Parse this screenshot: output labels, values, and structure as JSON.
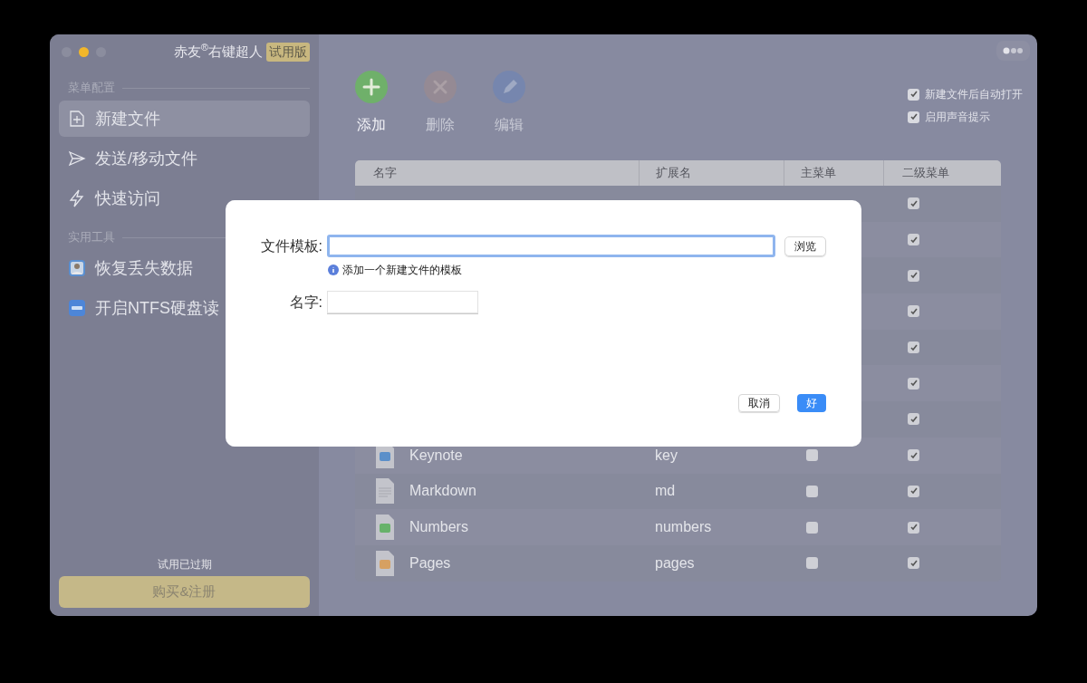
{
  "window": {
    "title": "赤友$^{®}$右键超人",
    "badge": "试用版"
  },
  "sidebar": {
    "sections": [
      {
        "title": "菜单配置",
        "items": [
          {
            "label": "新建文件",
            "kind": "file-plus",
            "selected": true
          },
          {
            "label": "发送/移动文件",
            "kind": "send",
            "selected": false
          },
          {
            "label": "快速访问",
            "kind": "bolt",
            "selected": false
          }
        ]
      },
      {
        "title": "实用工具",
        "items": [
          {
            "label": "恢复丢失数据",
            "kind": "app-person",
            "selected": false
          },
          {
            "label": "开启NTFS硬盘读",
            "kind": "app-disk",
            "selected": false
          }
        ]
      }
    ],
    "trial_note": "试用已过期",
    "buy_button": "购买&注册"
  },
  "toolbar": [
    {
      "label": "添加",
      "kind": "add",
      "disabled": false
    },
    {
      "label": "删除",
      "kind": "delete",
      "disabled": true
    },
    {
      "label": "编辑",
      "kind": "edit",
      "disabled": true
    }
  ],
  "options": [
    {
      "label": "新建文件后自动打开",
      "checked": true
    },
    {
      "label": "启用声音提示",
      "checked": true
    }
  ],
  "table": {
    "columns": [
      "名字",
      "扩展名",
      "主菜单",
      "二级菜单"
    ],
    "rows": [
      {
        "submenu": true
      },
      {
        "submenu": true
      },
      {
        "submenu": true
      },
      {
        "submenu": true
      },
      {
        "submenu": true
      },
      {
        "submenu": true
      },
      {
        "submenu": true
      },
      {
        "name": "Keynote",
        "extension": "key",
        "kind": "keynote",
        "main_menu": false,
        "submenu": true
      },
      {
        "name": "Markdown",
        "extension": "md",
        "kind": "text",
        "main_menu": false,
        "submenu": true
      },
      {
        "name": "Numbers",
        "extension": "numbers",
        "kind": "numbers",
        "main_menu": false,
        "submenu": true
      },
      {
        "name": "Pages",
        "extension": "pages",
        "kind": "pages",
        "main_menu": false,
        "submenu": true
      }
    ]
  },
  "dialog": {
    "fields": [
      {
        "label": "文件模板:",
        "kind": "wide",
        "focused": true,
        "button": "浏览",
        "hint": "添加一个新建文件的模板"
      },
      {
        "label": "名字:",
        "kind": "short",
        "focused": false
      }
    ],
    "buttons": [
      {
        "label": "取消",
        "primary": false
      },
      {
        "label": "好",
        "primary": true
      }
    ]
  }
}
